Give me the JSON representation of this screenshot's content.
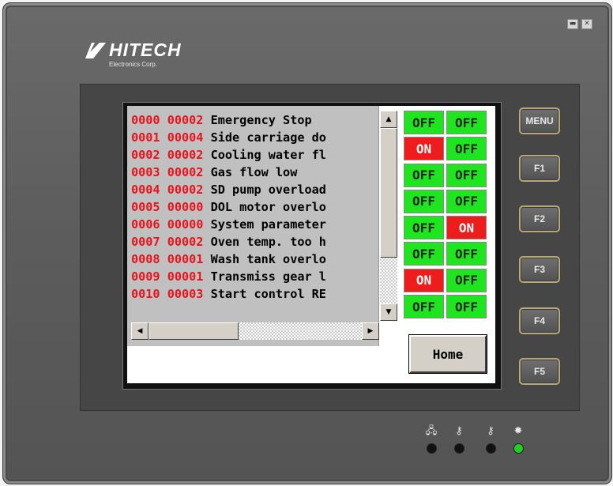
{
  "window_controls": {
    "minimize": "▬",
    "close": "✕"
  },
  "logo": {
    "name": "HITECH",
    "subtitle": "Electronics Corp."
  },
  "alarm_list": {
    "rows": [
      {
        "index": "0000",
        "code": "00002",
        "message": "Emergency Stop"
      },
      {
        "index": "0001",
        "code": "00004",
        "message": "Side carriage do"
      },
      {
        "index": "0002",
        "code": "00002",
        "message": "Cooling water fl"
      },
      {
        "index": "0003",
        "code": "00002",
        "message": "Gas flow low"
      },
      {
        "index": "0004",
        "code": "00002",
        "message": "SD pump overload"
      },
      {
        "index": "0005",
        "code": "00000",
        "message": "DOL motor overlo"
      },
      {
        "index": "0006",
        "code": "00000",
        "message": "System parameter"
      },
      {
        "index": "0007",
        "code": "00002",
        "message": "Oven temp. too h"
      },
      {
        "index": "0008",
        "code": "00001",
        "message": "Wash tank overlo"
      },
      {
        "index": "0009",
        "code": "00001",
        "message": "Transmiss gear l"
      },
      {
        "index": "0010",
        "code": "00003",
        "message": "Start control RE"
      }
    ]
  },
  "status_grid": [
    [
      "OFF",
      "OFF"
    ],
    [
      "ON",
      "OFF"
    ],
    [
      "OFF",
      "OFF"
    ],
    [
      "OFF",
      "OFF"
    ],
    [
      "OFF",
      "ON"
    ],
    [
      "OFF",
      "OFF"
    ],
    [
      "ON",
      "OFF"
    ],
    [
      "OFF",
      "OFF"
    ]
  ],
  "home_button": "Home",
  "function_keys": [
    "MENU",
    "F1",
    "F2",
    "F3",
    "F4",
    "F5"
  ],
  "indicators": [
    {
      "icon": "network-icon",
      "glyph": "🖧",
      "led": "off"
    },
    {
      "icon": "key-icon",
      "glyph": "⚷",
      "led": "off"
    },
    {
      "icon": "key-icon",
      "glyph": "⚷",
      "led": "off"
    },
    {
      "icon": "power-light-icon",
      "glyph": "✹",
      "led": "on"
    }
  ],
  "colors": {
    "on": "#ee1c1c",
    "off": "#1ee51e",
    "code_text": "#e8131b",
    "led_on": "#22d022"
  }
}
